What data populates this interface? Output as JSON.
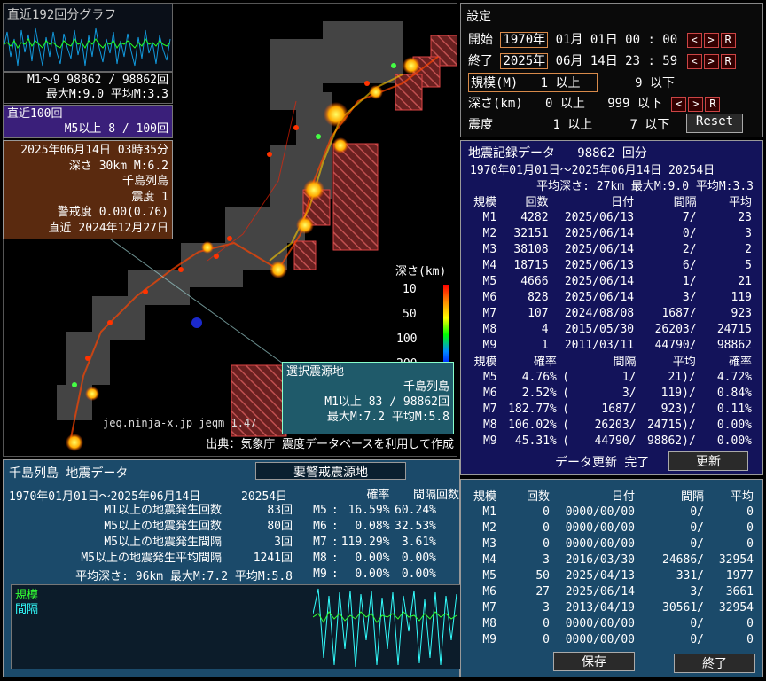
{
  "mini_graph": {
    "title": "直近192回分グラフ",
    "line1": "M1～9 98862 / 98862回",
    "line2": "最大M:9.0 平均M:3.3"
  },
  "recent100": {
    "title": "直近100回",
    "line": "M5以上    8 / 100回"
  },
  "quake_info": {
    "datetime": "2025年06月14日 03時35分",
    "depth_mag": "深さ 30km  M:6.2",
    "region": "千島列島",
    "intensity": "震度 1",
    "alert": "警戒度 0.00(0.76)",
    "recent": "直近 2024年12月27日"
  },
  "depth_legend": {
    "title": "深さ(km)",
    "ticks": [
      "10",
      "50",
      "100",
      "200"
    ]
  },
  "selected_area": {
    "title": "選択震源地",
    "region": "千島列島",
    "line1": "M1以上    83 / 98862回",
    "line2": "最大M:7.2 平均M:5.8"
  },
  "version": "jeq.ninja-x.jp jeqm 1.47",
  "credit": "出典：気象庁 震度データベースを利用して作成",
  "settings": {
    "title": "設定",
    "start_label": "開始",
    "start_year": "1970年",
    "start_rest": "01月 01日 00 : 00",
    "end_label": "終了",
    "end_year": "2025年",
    "end_rest": "06月 14日 23 : 59",
    "scale_label": "規模(M)",
    "scale_min": "1",
    "scale_min_unit": "以上",
    "scale_max": "9",
    "scale_max_unit": "以下",
    "depth_label": "深さ(km)",
    "depth_min": "0",
    "depth_min_unit": "以上",
    "depth_max": "999",
    "depth_max_unit": "以下",
    "int_label": "震度",
    "int_min": "1",
    "int_min_unit": "以上",
    "int_max": "7",
    "int_max_unit": "以下",
    "prev": "<",
    "next": ">",
    "reset_r": "R",
    "reset": "Reset"
  },
  "records": {
    "title": "地震記録データ",
    "count": "98862 回分",
    "range": "1970年01月01日～2025年06月14日  20254日",
    "stats": "平均深さ: 27km 最大M:9.0 平均M:3.3",
    "headers": [
      "規模",
      "回数",
      "日付",
      "間隔",
      "平均"
    ],
    "rows": [
      [
        "M1",
        "4282",
        "2025/06/13",
        "7/",
        "23"
      ],
      [
        "M2",
        "32151",
        "2025/06/14",
        "0/",
        "3"
      ],
      [
        "M3",
        "38108",
        "2025/06/14",
        "2/",
        "2"
      ],
      [
        "M4",
        "18715",
        "2025/06/13",
        "6/",
        "5"
      ],
      [
        "M5",
        "4666",
        "2025/06/14",
        "1/",
        "21"
      ],
      [
        "M6",
        "828",
        "2025/06/14",
        "3/",
        "119"
      ],
      [
        "M7",
        "107",
        "2024/08/08",
        "1687/",
        "923"
      ],
      [
        "M8",
        "4",
        "2015/05/30",
        "26203/",
        "24715"
      ],
      [
        "M9",
        "1",
        "2011/03/11",
        "44790/",
        "98862"
      ]
    ],
    "prob_headers": [
      "規模",
      "確率",
      "間隔",
      "平均",
      "確率"
    ],
    "prob_rows": [
      [
        "M5",
        "4.76%",
        "(",
        "1/",
        "21)/",
        "4.72%"
      ],
      [
        "M6",
        "2.52%",
        "(",
        "3/",
        "119)/",
        "0.84%"
      ],
      [
        "M7",
        "182.77%",
        "(",
        "1687/",
        "923)/",
        "0.11%"
      ],
      [
        "M8",
        "106.02%",
        "(",
        "26203/",
        "24715)/",
        "0.00%"
      ],
      [
        "M9",
        "45.31%",
        "(",
        "44790/",
        "98862)/",
        "0.00%"
      ]
    ],
    "status": "データ更新 完了",
    "update": "更新"
  },
  "bottom": {
    "title": "千島列島 地震データ",
    "tab2": "要警戒震源地",
    "range": "1970年01月01日～2025年06月14日",
    "days": "20254日",
    "lines": [
      [
        "M1以上の地震発生回数",
        "83回"
      ],
      [
        "M5以上の地震発生回数",
        "80回"
      ],
      [
        "M5以上の地震発生間隔",
        "3回"
      ],
      [
        "M5以上の地震発生平均間隔",
        "1241回"
      ]
    ],
    "avg": "平均深さ: 96km 最大M:7.2 平均M:5.8",
    "prob_headers": [
      "確率",
      "間隔",
      "回数"
    ],
    "prob_rows": [
      [
        "M5",
        ":",
        "16.59%",
        "60.24%"
      ],
      [
        "M6",
        ":",
        "0.08%",
        "32.53%"
      ],
      [
        "M7",
        ":",
        "119.29%",
        "3.61%"
      ],
      [
        "M8",
        ":",
        "0.00%",
        "0.00%"
      ],
      [
        "M9",
        ":",
        "0.00%",
        "0.00%"
      ]
    ],
    "legend_scale": "規模",
    "legend_interval": "間隔",
    "right_headers": [
      "規模",
      "回数",
      "日付",
      "間隔",
      "平均"
    ],
    "right_rows": [
      [
        "M1",
        "0",
        "0000/00/00",
        "0/",
        "0"
      ],
      [
        "M2",
        "0",
        "0000/00/00",
        "0/",
        "0"
      ],
      [
        "M3",
        "0",
        "0000/00/00",
        "0/",
        "0"
      ],
      [
        "M4",
        "3",
        "2016/03/30",
        "24686/",
        "32954"
      ],
      [
        "M5",
        "50",
        "2025/04/13",
        "331/",
        "1977"
      ],
      [
        "M6",
        "27",
        "2025/06/14",
        "3/",
        "3661"
      ],
      [
        "M7",
        "3",
        "2013/04/19",
        "30561/",
        "32954"
      ],
      [
        "M8",
        "0",
        "0000/00/00",
        "0/",
        "0"
      ],
      [
        "M9",
        "0",
        "0000/00/00",
        "0/",
        "0"
      ]
    ],
    "save": "保存",
    "quit": "終了"
  },
  "colors": {
    "map_bg": "#000000",
    "records_bg": "#13135a",
    "bottom_bg": "#1b4a6a",
    "settings_accent": "#d88a4a",
    "arrow_border": "#cc4444"
  }
}
